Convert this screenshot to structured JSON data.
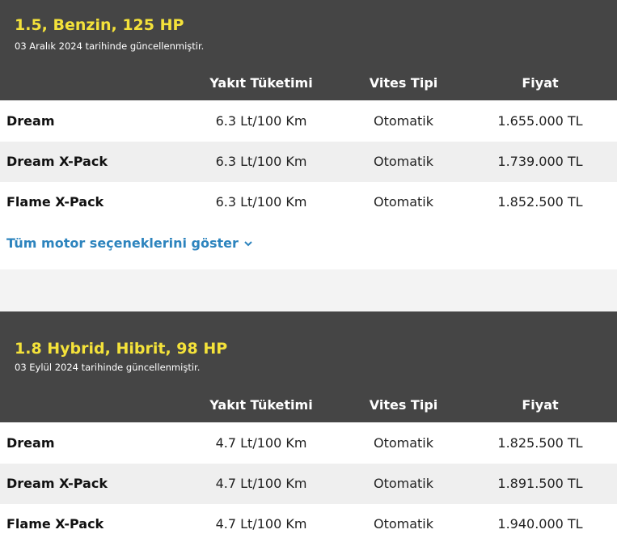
{
  "sections": [
    {
      "title": "1.5, Benzin, 125 HP",
      "updated": "03 Aralık 2024 tarihinde güncellenmiştir.",
      "columns": [
        "Yakıt Tüketimi",
        "Vites Tipi",
        "Fiyat"
      ],
      "rows": [
        {
          "name": "Dream",
          "fuel": "6.3 Lt/100 Km",
          "gear": "Otomatik",
          "price": "1.655.000 TL"
        },
        {
          "name": "Dream X-Pack",
          "fuel": "6.3 Lt/100 Km",
          "gear": "Otomatik",
          "price": "1.739.000 TL"
        },
        {
          "name": "Flame X-Pack",
          "fuel": "6.3 Lt/100 Km",
          "gear": "Otomatik",
          "price": "1.852.500 TL"
        }
      ],
      "more_label": "Tüm motor seçeneklerini göster"
    },
    {
      "title": "1.8 Hybrid, Hibrit, 98 HP",
      "updated": "03 Eylül 2024 tarihinde güncellenmiştir.",
      "columns": [
        "Yakıt Tüketimi",
        "Vites Tipi",
        "Fiyat"
      ],
      "rows": [
        {
          "name": "Dream",
          "fuel": "4.7 Lt/100 Km",
          "gear": "Otomatik",
          "price": "1.825.500 TL"
        },
        {
          "name": "Dream X-Pack",
          "fuel": "4.7 Lt/100 Km",
          "gear": "Otomatik",
          "price": "1.891.500 TL"
        },
        {
          "name": "Flame X-Pack",
          "fuel": "4.7 Lt/100 Km",
          "gear": "Otomatik",
          "price": "1.940.000 TL"
        }
      ]
    }
  ],
  "colors": {
    "header_bg": "#454545",
    "title": "#f4e23a",
    "link": "#2d84be"
  }
}
